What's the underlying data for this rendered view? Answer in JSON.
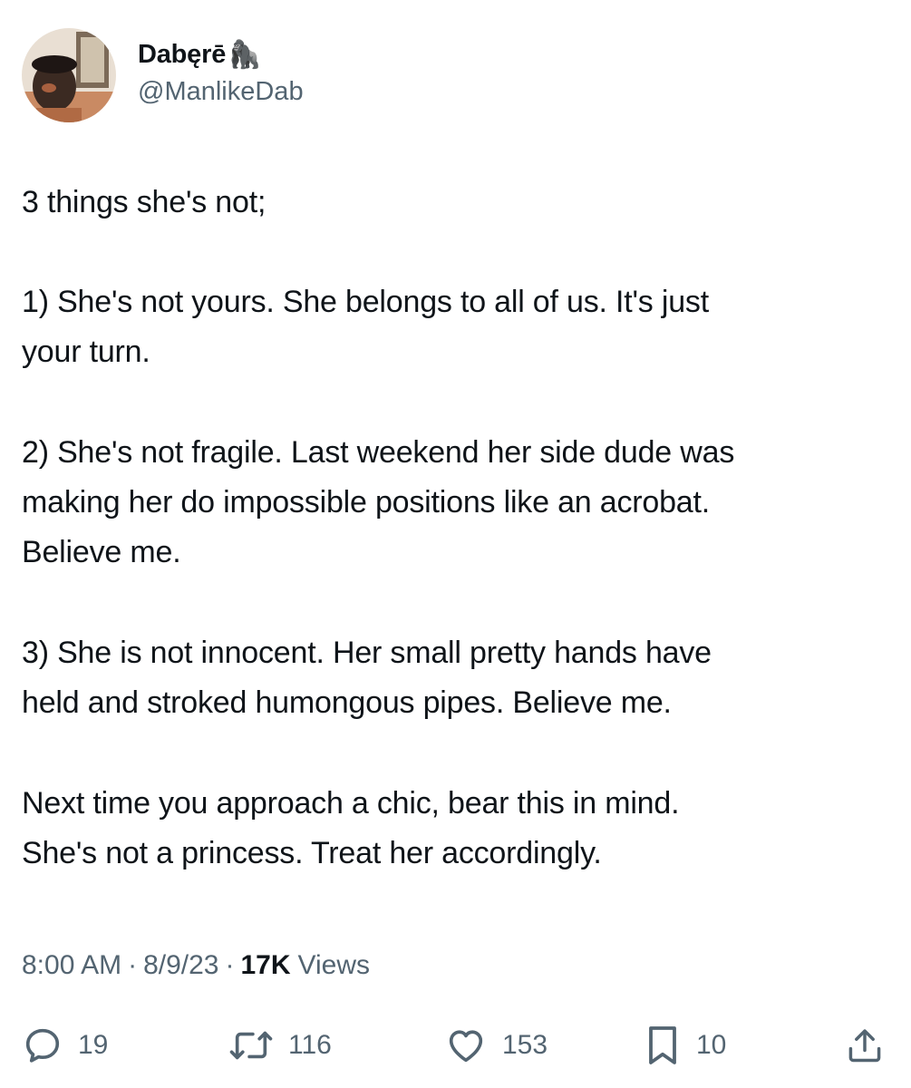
{
  "author": {
    "display_name": "Dabęrē",
    "name_emoji": "🦍",
    "handle": "@ManlikeDab",
    "avatar_icon": "profile-photo"
  },
  "tweet": {
    "paragraphs": [
      "3 things she's not;",
      "1) She's not yours. She belongs to all of us. It's just\nyour turn.",
      "2) She's not fragile. Last weekend her side dude was\nmaking her do impossible positions like an acrobat.\nBelieve me.",
      "3) She is not innocent. Her small pretty hands have\nheld and stroked humongous pipes. Believe me.",
      "Next time you approach a chic, bear this in mind.\nShe's not a princess. Treat her accordingly."
    ]
  },
  "meta": {
    "time": "8:00 AM",
    "separator": "·",
    "date": "8/9/23",
    "views_count": "17K",
    "views_label": "Views"
  },
  "actions": {
    "reply": {
      "icon": "reply-icon",
      "count": "19"
    },
    "retweet": {
      "icon": "retweet-icon",
      "count": "116"
    },
    "like": {
      "icon": "heart-icon",
      "count": "153"
    },
    "bookmark": {
      "icon": "bookmark-icon",
      "count": "10"
    },
    "share": {
      "icon": "share-icon"
    }
  },
  "colors": {
    "text_primary": "#0f1419",
    "text_secondary": "#536471",
    "background": "#ffffff"
  }
}
